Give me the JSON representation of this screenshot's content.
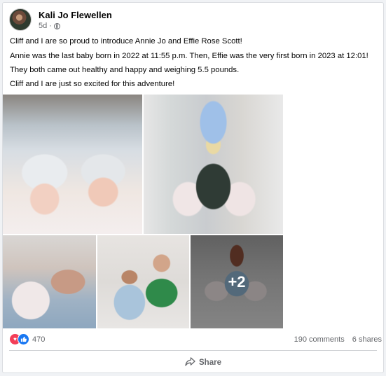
{
  "post": {
    "author": "Kali Jo Flewellen",
    "time": "5d",
    "paragraphs": [
      "Cliff and I are so proud to introduce Annie Jo and Effie Rose Scott!",
      "Annie was the last baby born in 2022 at 11:55 p.m. Then, Effie was the very first born in 2023 at 12:01!",
      "They both came out healthy and happy and weighing 5.5 pounds.",
      "Cliff and I are just so excited for this adventure!"
    ],
    "more_photos": "+2"
  },
  "reactions": {
    "icons": [
      "love-icon",
      "like-icon"
    ],
    "count": "470"
  },
  "stats": {
    "comments": "190 comments",
    "shares": "6 shares"
  },
  "actions": {
    "share_label": "Share"
  },
  "colors": {
    "love": "#f33e58",
    "like": "#1877f2",
    "secondary_text": "#65676b"
  }
}
